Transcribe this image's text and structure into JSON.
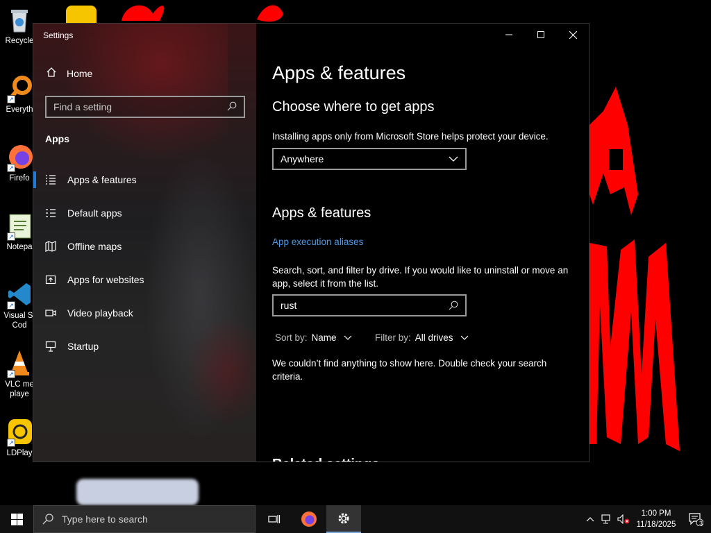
{
  "desktop": {
    "icons": [
      {
        "name": "recycle-bin",
        "label": "Recycle"
      },
      {
        "name": "everything",
        "label": "Everyth"
      },
      {
        "name": "firefox",
        "label": "Firefo"
      },
      {
        "name": "notepad",
        "label": "Notepa"
      },
      {
        "name": "vscode",
        "label_line1": "Visual St",
        "label_line2": "Cod"
      },
      {
        "name": "vlc",
        "label_line1": "VLC me",
        "label_line2": "playe"
      },
      {
        "name": "ldplayer",
        "label": "LDPlay"
      }
    ]
  },
  "window": {
    "title": "Settings",
    "controls": {
      "minimize": "—",
      "maximize": "☐",
      "close": "✕"
    }
  },
  "sidebar": {
    "home_label": "Home",
    "search_placeholder": "Find a setting",
    "section_heading": "Apps",
    "items": [
      {
        "label": "Apps & features",
        "icon": "list-icon",
        "selected": true
      },
      {
        "label": "Default apps",
        "icon": "default-apps-icon",
        "selected": false
      },
      {
        "label": "Offline maps",
        "icon": "map-icon",
        "selected": false
      },
      {
        "label": "Apps for websites",
        "icon": "open-in-icon",
        "selected": false
      },
      {
        "label": "Video playback",
        "icon": "video-icon",
        "selected": false
      },
      {
        "label": "Startup",
        "icon": "startup-icon",
        "selected": false
      }
    ]
  },
  "main": {
    "page_title": "Apps & features",
    "choose_heading": "Choose where to get apps",
    "choose_description": "Installing apps only from Microsoft Store helps protect your device.",
    "source_dropdown_value": "Anywhere",
    "section_heading": "Apps & features",
    "aliases_link": "App execution aliases",
    "search_description": "Search, sort, and filter by drive. If you would like to uninstall or move an app, select it from the list.",
    "search_value": "rust",
    "sort_label": "Sort by:",
    "sort_value": "Name",
    "filter_label": "Filter by:",
    "filter_value": "All drives",
    "empty_message": "We couldn’t find anything to show here. Double check your search criteria.",
    "related_settings_cutoff": "Related settings"
  },
  "taskbar": {
    "search_placeholder": "Type here to search",
    "time": "1:00 PM",
    "date": "11/18/2025",
    "notification_count": "3"
  },
  "colors": {
    "accent": "#1f7ad6",
    "link": "#4a9ae8",
    "scribble": "#ff0000"
  }
}
